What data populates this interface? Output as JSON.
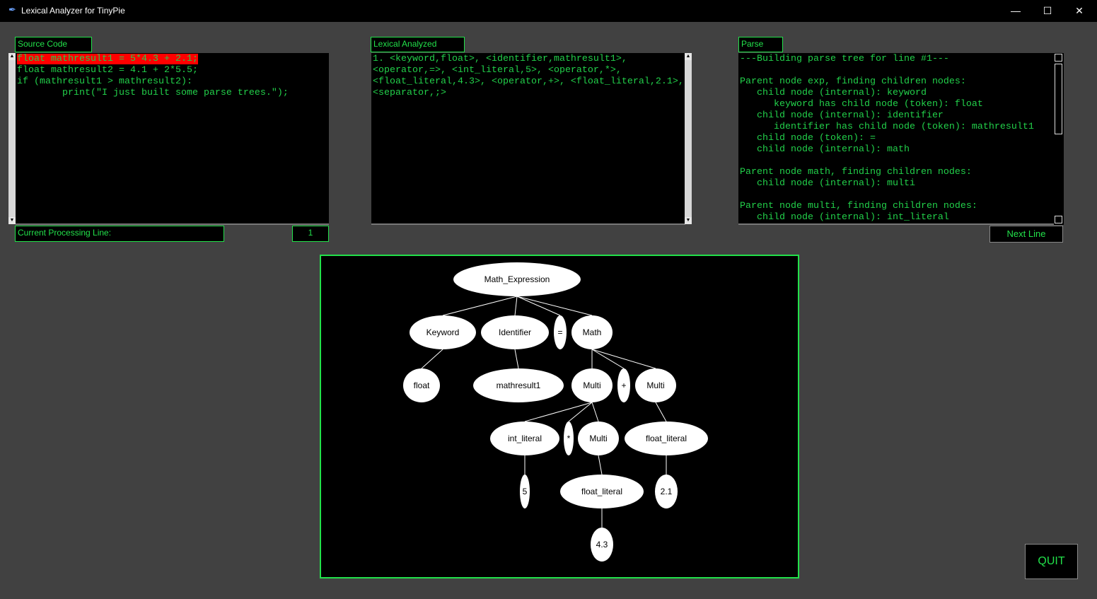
{
  "window": {
    "title": "Lexical Analyzer for TinyPie",
    "icon": "feather-icon",
    "controls": [
      "minimize",
      "maximize",
      "close"
    ]
  },
  "source": {
    "label": "Source Code Input:",
    "lines": [
      "float mathresult1 = 5*4.3 + 2.1;",
      "float mathresult2 = 4.1 + 2*5.5;",
      "if (mathresult1 > mathresult2):",
      "        print(\"I just built some parse trees.\");"
    ],
    "highlight_line": 1,
    "highlight_color": "#ff0000"
  },
  "lexical": {
    "label": "Lexical Analyzed Result:",
    "lines": [
      "1. <keyword,float>, <identifier,mathresult1>,",
      "<operator,=>, <int_literal,5>, <operator,*>,",
      "<float_literal,4.3>, <operator,+>, <float_literal,2.1>,",
      "<separator,;>"
    ]
  },
  "parse": {
    "label": "Parse Tree:",
    "lines": [
      "---Building parse tree for line #1---",
      "",
      "Parent node exp, finding children nodes:",
      "   child node (internal): keyword",
      "      keyword has child node (token): float",
      "   child node (internal): identifier",
      "      identifier has child node (token): mathresult1",
      "   child node (token): =",
      "   child node (internal): math",
      "",
      "Parent node math, finding children nodes:",
      "   child node (internal): multi",
      "",
      "Parent node multi, finding children nodes:",
      "   child node (internal): int_literal"
    ]
  },
  "processing": {
    "label": "Current Processing Line:",
    "value": "1"
  },
  "buttons": {
    "next_line": "Next  Line",
    "quit": "QUIT"
  },
  "colors": {
    "accent": "#22e04a",
    "background": "#414141"
  },
  "tree": {
    "nodes": [
      {
        "id": "root",
        "label": "Math_Expression"
      },
      {
        "id": "kw",
        "label": "Keyword"
      },
      {
        "id": "id",
        "label": "Identifier"
      },
      {
        "id": "eq",
        "label": "="
      },
      {
        "id": "math",
        "label": "Math"
      },
      {
        "id": "float",
        "label": "float"
      },
      {
        "id": "mr1",
        "label": "mathresult1"
      },
      {
        "id": "m1",
        "label": "Multi"
      },
      {
        "id": "plus",
        "label": "+"
      },
      {
        "id": "m2",
        "label": "Multi"
      },
      {
        "id": "il",
        "label": "int_literal"
      },
      {
        "id": "star",
        "label": "*"
      },
      {
        "id": "m3",
        "label": "Multi"
      },
      {
        "id": "fl1",
        "label": "float_literal"
      },
      {
        "id": "five",
        "label": "5"
      },
      {
        "id": "fl2",
        "label": "float_literal"
      },
      {
        "id": "v21",
        "label": "2.1"
      },
      {
        "id": "v43",
        "label": "4.3"
      }
    ],
    "edges": [
      [
        "root",
        "kw"
      ],
      [
        "root",
        "id"
      ],
      [
        "root",
        "eq"
      ],
      [
        "root",
        "math"
      ],
      [
        "kw",
        "float"
      ],
      [
        "id",
        "mr1"
      ],
      [
        "math",
        "m1"
      ],
      [
        "math",
        "plus"
      ],
      [
        "math",
        "m2"
      ],
      [
        "m1",
        "il"
      ],
      [
        "m1",
        "star"
      ],
      [
        "m1",
        "m3"
      ],
      [
        "m2",
        "fl1"
      ],
      [
        "il",
        "five"
      ],
      [
        "m3",
        "fl2"
      ],
      [
        "fl1",
        "v21"
      ],
      [
        "fl2",
        "v43"
      ]
    ]
  }
}
